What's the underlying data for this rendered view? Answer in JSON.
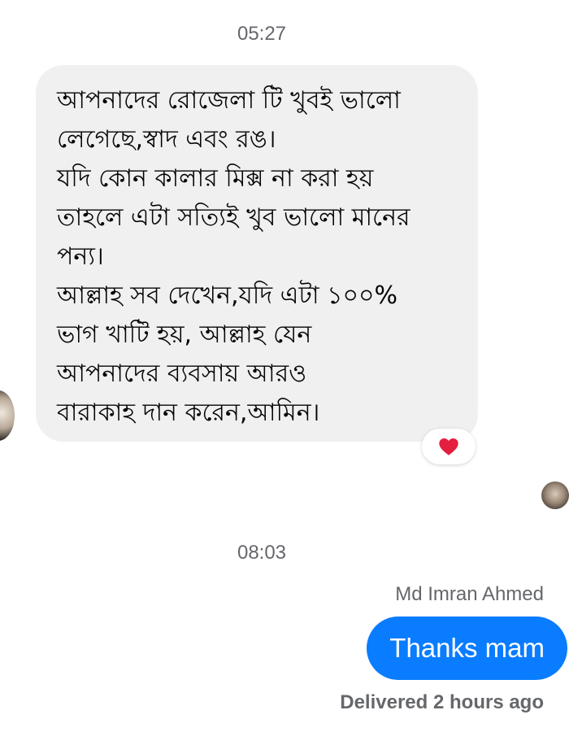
{
  "conversation": {
    "timestamps": [
      "05:27",
      "08:03"
    ],
    "incoming_message": {
      "lines": [
        "আপনাদের রোজেলা টি খুবই ভালো",
        "লেগেছে,স্বাদ এবং রঙ।",
        "যদি কোন কালার মিক্স না করা হয়",
        "তাহলে এটা সত্যিই খুব ভালো মানের",
        "পন্য।",
        "আল্লাহ সব দেখেন,যদি এটা ১০০%",
        "ভাগ খাটি হয়, আল্লাহ যেন",
        "আপনাদের ব্যবসায় আরও",
        "বারাকাহ দান করেন,আমিন।"
      ],
      "reaction": "heart-icon"
    },
    "outgoing_message": {
      "sender_name": "Md Imran Ahmed",
      "text": "Thanks mam",
      "status": "Delivered 2 hours ago"
    }
  },
  "colors": {
    "incoming_bubble": "#f0f0f0",
    "outgoing_bubble": "#0a7cff",
    "secondary_text": "#65676b",
    "reaction_heart": "#e41e3f"
  }
}
